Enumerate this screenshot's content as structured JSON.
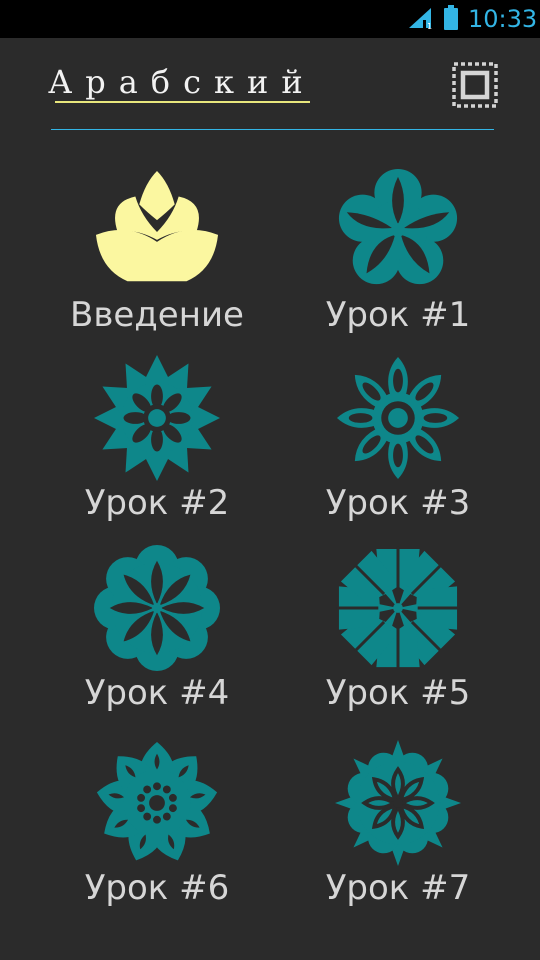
{
  "status_bar": {
    "time": "10:33",
    "signal_icon": "signal-icon",
    "battery_icon": "battery-icon",
    "accent_color": "#33b5e5"
  },
  "header": {
    "title": "Арабский",
    "menu_icon": "frame-icon"
  },
  "colors": {
    "background": "#2b2b2b",
    "lotus": "#fbf7a0",
    "flower": "#0e878a",
    "label": "#d6d6d6"
  },
  "lessons": [
    {
      "label": "Введение",
      "icon": "lotus-icon"
    },
    {
      "label": "Урок #1",
      "icon": "flower-1-icon"
    },
    {
      "label": "Урок #2",
      "icon": "flower-2-icon"
    },
    {
      "label": "Урок #3",
      "icon": "flower-3-icon"
    },
    {
      "label": "Урок #4",
      "icon": "flower-4-icon"
    },
    {
      "label": "Урок #5",
      "icon": "flower-5-icon"
    },
    {
      "label": "Урок #6",
      "icon": "flower-6-icon"
    },
    {
      "label": "Урок #7",
      "icon": "flower-7-icon"
    }
  ]
}
